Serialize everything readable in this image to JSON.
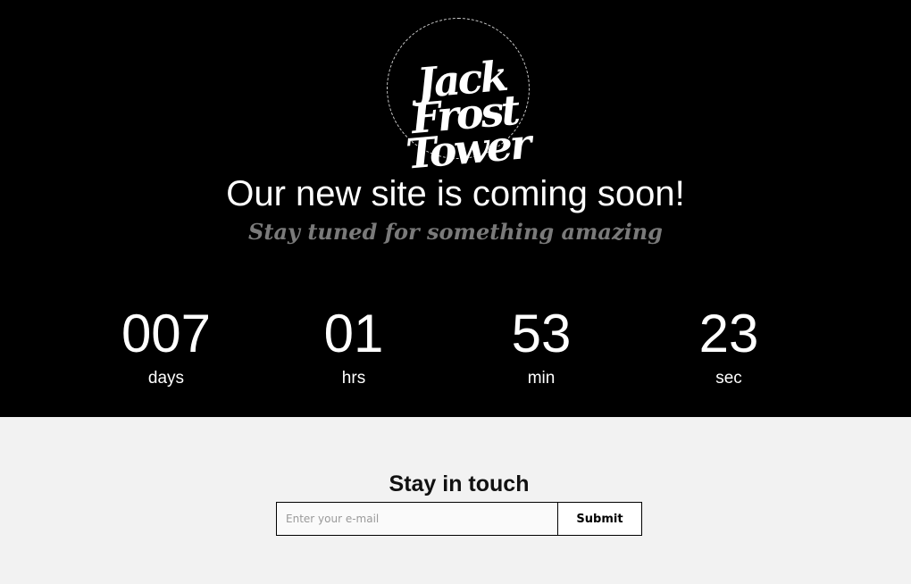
{
  "logo": {
    "lines": [
      "Jack",
      "Frost",
      "Tower"
    ]
  },
  "hero": {
    "headline": "Our new site is coming soon!",
    "tagline": "Stay tuned for something amazing"
  },
  "countdown": [
    {
      "value": "007",
      "label": "days"
    },
    {
      "value": "01",
      "label": "hrs"
    },
    {
      "value": "53",
      "label": "min"
    },
    {
      "value": "23",
      "label": "sec"
    }
  ],
  "subscribe": {
    "title": "Stay in touch",
    "email_placeholder": "Enter your e-mail",
    "submit_label": "Submit"
  },
  "colors": {
    "hero_bg": "#000000",
    "lower_bg": "#f2f2f2",
    "tagline": "#7a7a7a"
  }
}
